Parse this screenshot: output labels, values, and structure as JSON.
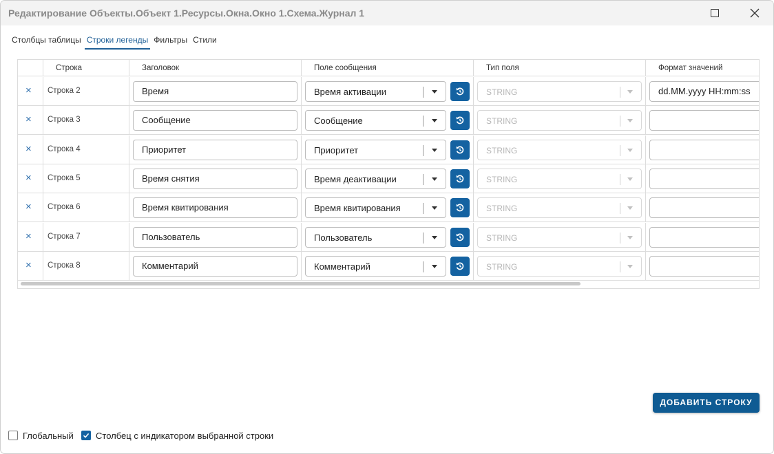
{
  "window": {
    "title": "Редактирование Объекты.Объект 1.Ресурсы.Окна.Окно 1.Схема.Журнал 1"
  },
  "tabs": [
    {
      "label": "Столбцы таблицы",
      "active": false
    },
    {
      "label": "Строки легенды",
      "active": true
    },
    {
      "label": "Фильтры",
      "active": false
    },
    {
      "label": "Стили",
      "active": false
    }
  ],
  "table": {
    "headers": [
      "Строка",
      "Заголовок",
      "Поле сообщения",
      "Тип поля",
      "Формат значений"
    ],
    "delete_glyph": "×",
    "rows": [
      {
        "name": "Строка 2",
        "title": "Время",
        "field": "Время активации",
        "type": "STRING",
        "format": "dd.MM.yyyy HH:mm:ss"
      },
      {
        "name": "Строка 3",
        "title": "Сообщение",
        "field": "Сообщение",
        "type": "STRING",
        "format": ""
      },
      {
        "name": "Строка 4",
        "title": "Приоритет",
        "field": "Приоритет",
        "type": "STRING",
        "format": ""
      },
      {
        "name": "Строка 5",
        "title": "Время снятия",
        "field": "Время деактивации",
        "type": "STRING",
        "format": ""
      },
      {
        "name": "Строка 6",
        "title": "Время квитирования",
        "field": "Время квитирования",
        "type": "STRING",
        "format": ""
      },
      {
        "name": "Строка 7",
        "title": "Пользователь",
        "field": "Пользователь",
        "type": "STRING",
        "format": ""
      },
      {
        "name": "Строка 8",
        "title": "Комментарий",
        "field": "Комментарий",
        "type": "STRING",
        "format": ""
      }
    ]
  },
  "actions": {
    "add_row_label": "ДОБАВИТЬ СТРОКУ"
  },
  "options": {
    "global": {
      "label": "Глобальный",
      "checked": false
    },
    "indicator": {
      "label": "Столбец с индикатором выбранной строки",
      "checked": true
    }
  },
  "colors": {
    "accent": "#1462a1",
    "accent_dark": "#0f5b93",
    "title_text": "#8a8a8a"
  },
  "icons": {
    "maximize": "maximize-icon",
    "close": "close-icon",
    "reset": "reset-icon",
    "delete": "delete-row-icon",
    "dropdown": "dropdown-arrow-icon",
    "check": "checkmark-icon"
  }
}
